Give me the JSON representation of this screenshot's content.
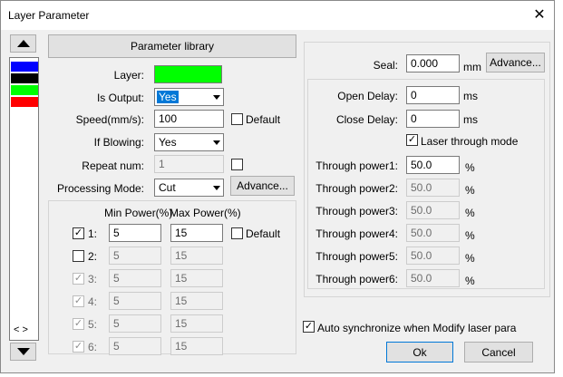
{
  "window": {
    "title": "Layer Parameter"
  },
  "colors": {
    "layer": "#00ff00",
    "accent": "#0078d7"
  },
  "layer_list": {
    "swatches": [
      "#0000ff",
      "#000000",
      "#00ff00",
      "#ff0000"
    ],
    "scroll_h_label": "< >"
  },
  "left": {
    "param_library_label": "Parameter library",
    "layer_label": "Layer:",
    "is_output_label": "Is Output:",
    "is_output_value": "Yes",
    "speed_label": "Speed(mm/s):",
    "speed_value": "100",
    "speed_default_label": "Default",
    "if_blowing_label": "If Blowing:",
    "if_blowing_value": "Yes",
    "repeat_label": "Repeat num:",
    "repeat_value": "1",
    "processing_label": "Processing Mode:",
    "processing_value": "Cut",
    "advance_label": "Advance..."
  },
  "power": {
    "min_header": "Min Power(%)",
    "max_header": "Max Power(%)",
    "default_label": "Default",
    "rows": [
      {
        "label": "1:",
        "checked": "✓",
        "min": "5",
        "max": "15"
      },
      {
        "label": "2:",
        "checked": "",
        "min": "5",
        "max": "15"
      },
      {
        "label": "3:",
        "checked": "✓",
        "min": "5",
        "max": "15"
      },
      {
        "label": "4:",
        "checked": "✓",
        "min": "5",
        "max": "15"
      },
      {
        "label": "5:",
        "checked": "✓",
        "min": "5",
        "max": "15"
      },
      {
        "label": "6:",
        "checked": "✓",
        "min": "5",
        "max": "15"
      }
    ]
  },
  "right": {
    "seal_label": "Seal:",
    "seal_value": "0.000",
    "seal_unit": "mm",
    "seal_advance_label": "Advance...",
    "open_delay_label": "Open Delay:",
    "open_delay_value": "0",
    "close_delay_label": "Close Delay:",
    "close_delay_value": "0",
    "delay_unit": "ms",
    "laser_through_label": "Laser through mode",
    "laser_through_checked": "✓",
    "percent": "%",
    "through": [
      {
        "label": "Through power1:",
        "value": "50.0"
      },
      {
        "label": "Through power2:",
        "value": "50.0"
      },
      {
        "label": "Through power3:",
        "value": "50.0"
      },
      {
        "label": "Through power4:",
        "value": "50.0"
      },
      {
        "label": "Through power5:",
        "value": "50.0"
      },
      {
        "label": "Through power6:",
        "value": "50.0"
      }
    ],
    "auto_sync_label": "Auto synchronize when Modify laser para",
    "auto_sync_checked": "✓"
  },
  "footer": {
    "ok_label": "Ok",
    "cancel_label": "Cancel"
  }
}
